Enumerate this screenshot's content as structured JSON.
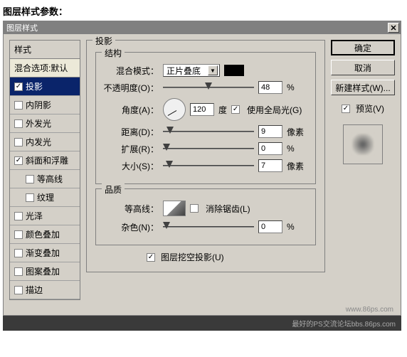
{
  "page_title": "图层样式参数：",
  "dialog": {
    "title": "图层样式",
    "close": "✕"
  },
  "styles_list": {
    "header": "样式",
    "blend_defaults": "混合选项:默认",
    "items": [
      {
        "label": "投影",
        "checked": true,
        "selected": true
      },
      {
        "label": "内阴影",
        "checked": false
      },
      {
        "label": "外发光",
        "checked": false
      },
      {
        "label": "内发光",
        "checked": false
      },
      {
        "label": "斜面和浮雕",
        "checked": true
      },
      {
        "label": "等高线",
        "checked": false,
        "sub": true
      },
      {
        "label": "纹理",
        "checked": false,
        "sub": true
      },
      {
        "label": "光泽",
        "checked": false
      },
      {
        "label": "颜色叠加",
        "checked": false
      },
      {
        "label": "渐变叠加",
        "checked": false
      },
      {
        "label": "图案叠加",
        "checked": false
      },
      {
        "label": "描边",
        "checked": false
      }
    ]
  },
  "effect": {
    "title": "投影",
    "structure": {
      "title": "结构",
      "blend_mode_label": "混合模式：",
      "blend_mode_value": "正片叠底",
      "opacity_label": "不透明度(O)：",
      "opacity_value": "48",
      "opacity_unit": "%",
      "angle_label": "角度(A)：",
      "angle_value": "120",
      "angle_unit": "度",
      "use_global_label": "使用全局光(G)",
      "distance_label": "距离(D)：",
      "distance_value": "9",
      "distance_unit": "像素",
      "spread_label": "扩展(R)：",
      "spread_value": "0",
      "spread_unit": "%",
      "size_label": "大小(S)：",
      "size_value": "7",
      "size_unit": "像素"
    },
    "quality": {
      "title": "品质",
      "contour_label": "等高线：",
      "antialias_label": "消除锯齿(L)",
      "noise_label": "杂色(N)：",
      "noise_value": "0",
      "noise_unit": "%"
    },
    "knockout_label": "图层挖空投影(U)"
  },
  "buttons": {
    "ok": "确定",
    "cancel": "取消",
    "new_style": "新建样式(W)...",
    "preview": "预览(V)"
  },
  "watermark": "www.86ps.com",
  "footer": "最好的PS交流论坛bbs.86ps.com"
}
